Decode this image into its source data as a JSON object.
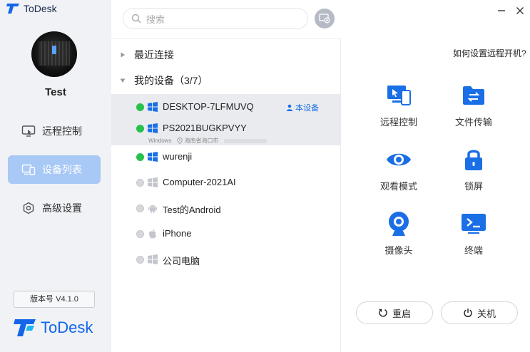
{
  "app": {
    "name": "ToDesk"
  },
  "user": {
    "name": "Test"
  },
  "nav": [
    {
      "label": "远程控制"
    },
    {
      "label": "设备列表"
    },
    {
      "label": "高级设置"
    }
  ],
  "version": "版本号 V4.1.0",
  "brand_bottom": "ToDesk",
  "search": {
    "placeholder": "搜索"
  },
  "groups": {
    "recent": "最近连接",
    "mine": "我的设备（3/7）"
  },
  "this_device_label": "本设备",
  "devices": [
    {
      "name": "DESKTOP-7LFMUVQ",
      "os": "windows",
      "online": true
    },
    {
      "name": "PS2021BUGKPVYY",
      "os": "windows",
      "online": true,
      "os_label": "Windows",
      "location": "海南省海口市"
    },
    {
      "name": "wurenji",
      "os": "windows",
      "online": true
    },
    {
      "name": "Computer-2021AI",
      "os": "windows",
      "online": false
    },
    {
      "name": "Test的Android",
      "os": "android",
      "online": false
    },
    {
      "name": "iPhone",
      "os": "apple",
      "online": false
    },
    {
      "name": "公司电脑",
      "os": "windows",
      "online": false
    }
  ],
  "right": {
    "help": "如何设置远程开机?",
    "actions": [
      {
        "label": "远程控制",
        "icon": "remote-control-icon"
      },
      {
        "label": "文件传输",
        "icon": "file-transfer-icon"
      },
      {
        "label": "观看模式",
        "icon": "eye-icon"
      },
      {
        "label": "锁屏",
        "icon": "lock-icon"
      },
      {
        "label": "摄像头",
        "icon": "camera-icon"
      },
      {
        "label": "终端",
        "icon": "terminal-icon"
      }
    ],
    "restart": "重启",
    "shutdown": "关机"
  },
  "colors": {
    "accent": "#1a6fe6",
    "online": "#27c24c",
    "nav_active": "#a8c8f5"
  }
}
